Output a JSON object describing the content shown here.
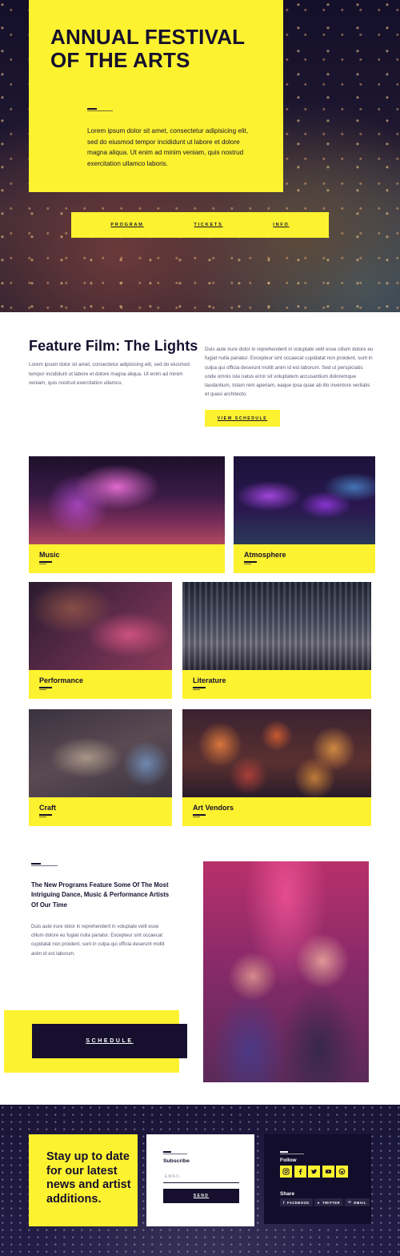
{
  "hero": {
    "title": "ANNUAL FESTIVAL OF THE ARTS",
    "description": "Lorem ipsum dolor sit amet, consectetur adipisicing elit, sed do eiusmod tempor incididunt ut labore et dolore magna aliqua. Ut enim ad minim veniam, quis nostrud exercitation ullamco laboris.",
    "nav": [
      "PROGRAM",
      "TICKETS",
      "INFO"
    ]
  },
  "feature": {
    "title": "Feature Film: The Lights",
    "left_text": "Lorem ipsum dolor sit amet, consectetur adipisicing elit, sed do eiusmod tempor incididunt ut labore et dolore magna aliqua. Ut enim ad minim veniam, quis nostrud exercitation ullamco.",
    "right_text": "Duis aute irure dolor in reprehenderit in voluptate velit esse cillum dolore eu fugiat nulla pariatur. Excepteur sint occaecat cupidatat non proident, sunt in culpa qui officia deserunt mollit anim id est laborum. Sed ut perspiciatis unde omnis iste natus error sit voluptatem accusantium doloremque laudantium, totam rem aperiam, eaque ipsa quae ab illo inventore veritatis et quasi architecto.",
    "button": "VIEW SCHEDULE"
  },
  "categories": [
    {
      "label": "Music"
    },
    {
      "label": "Atmosphere"
    },
    {
      "label": "Performance"
    },
    {
      "label": "Literature"
    },
    {
      "label": "Craft"
    },
    {
      "label": "Art Vendors"
    }
  ],
  "programs": {
    "title": "The New Programs Feature Some Of The Most Intriguing Dance, Music & Performance Artists Of Our Time",
    "text": "Duis aute irure dolor in reprehenderit in voluptate velit esse cillum dolore eu fugiat nulla pariatur. Excepteur sint occaecat cupidatat non proident, sunt in culpa qui officia deserunt mollit anim id est laborum.",
    "button": "SCHEDULE"
  },
  "footer": {
    "cta": "Stay up to date for our latest news and artist additions.",
    "subscribe_title": "Subscribe",
    "email_placeholder": "EMAIL",
    "send_button": "SEND",
    "follow_title": "Follow",
    "social_icons": [
      "instagram-icon",
      "facebook-icon",
      "twitter-icon",
      "youtube-icon",
      "wordpress-icon"
    ],
    "share_title": "Share",
    "share": [
      "FACEBOOK",
      "TWITTER",
      "EMAIL"
    ]
  },
  "colors": {
    "accent_yellow": "#fdf230",
    "navy": "#16102e"
  }
}
